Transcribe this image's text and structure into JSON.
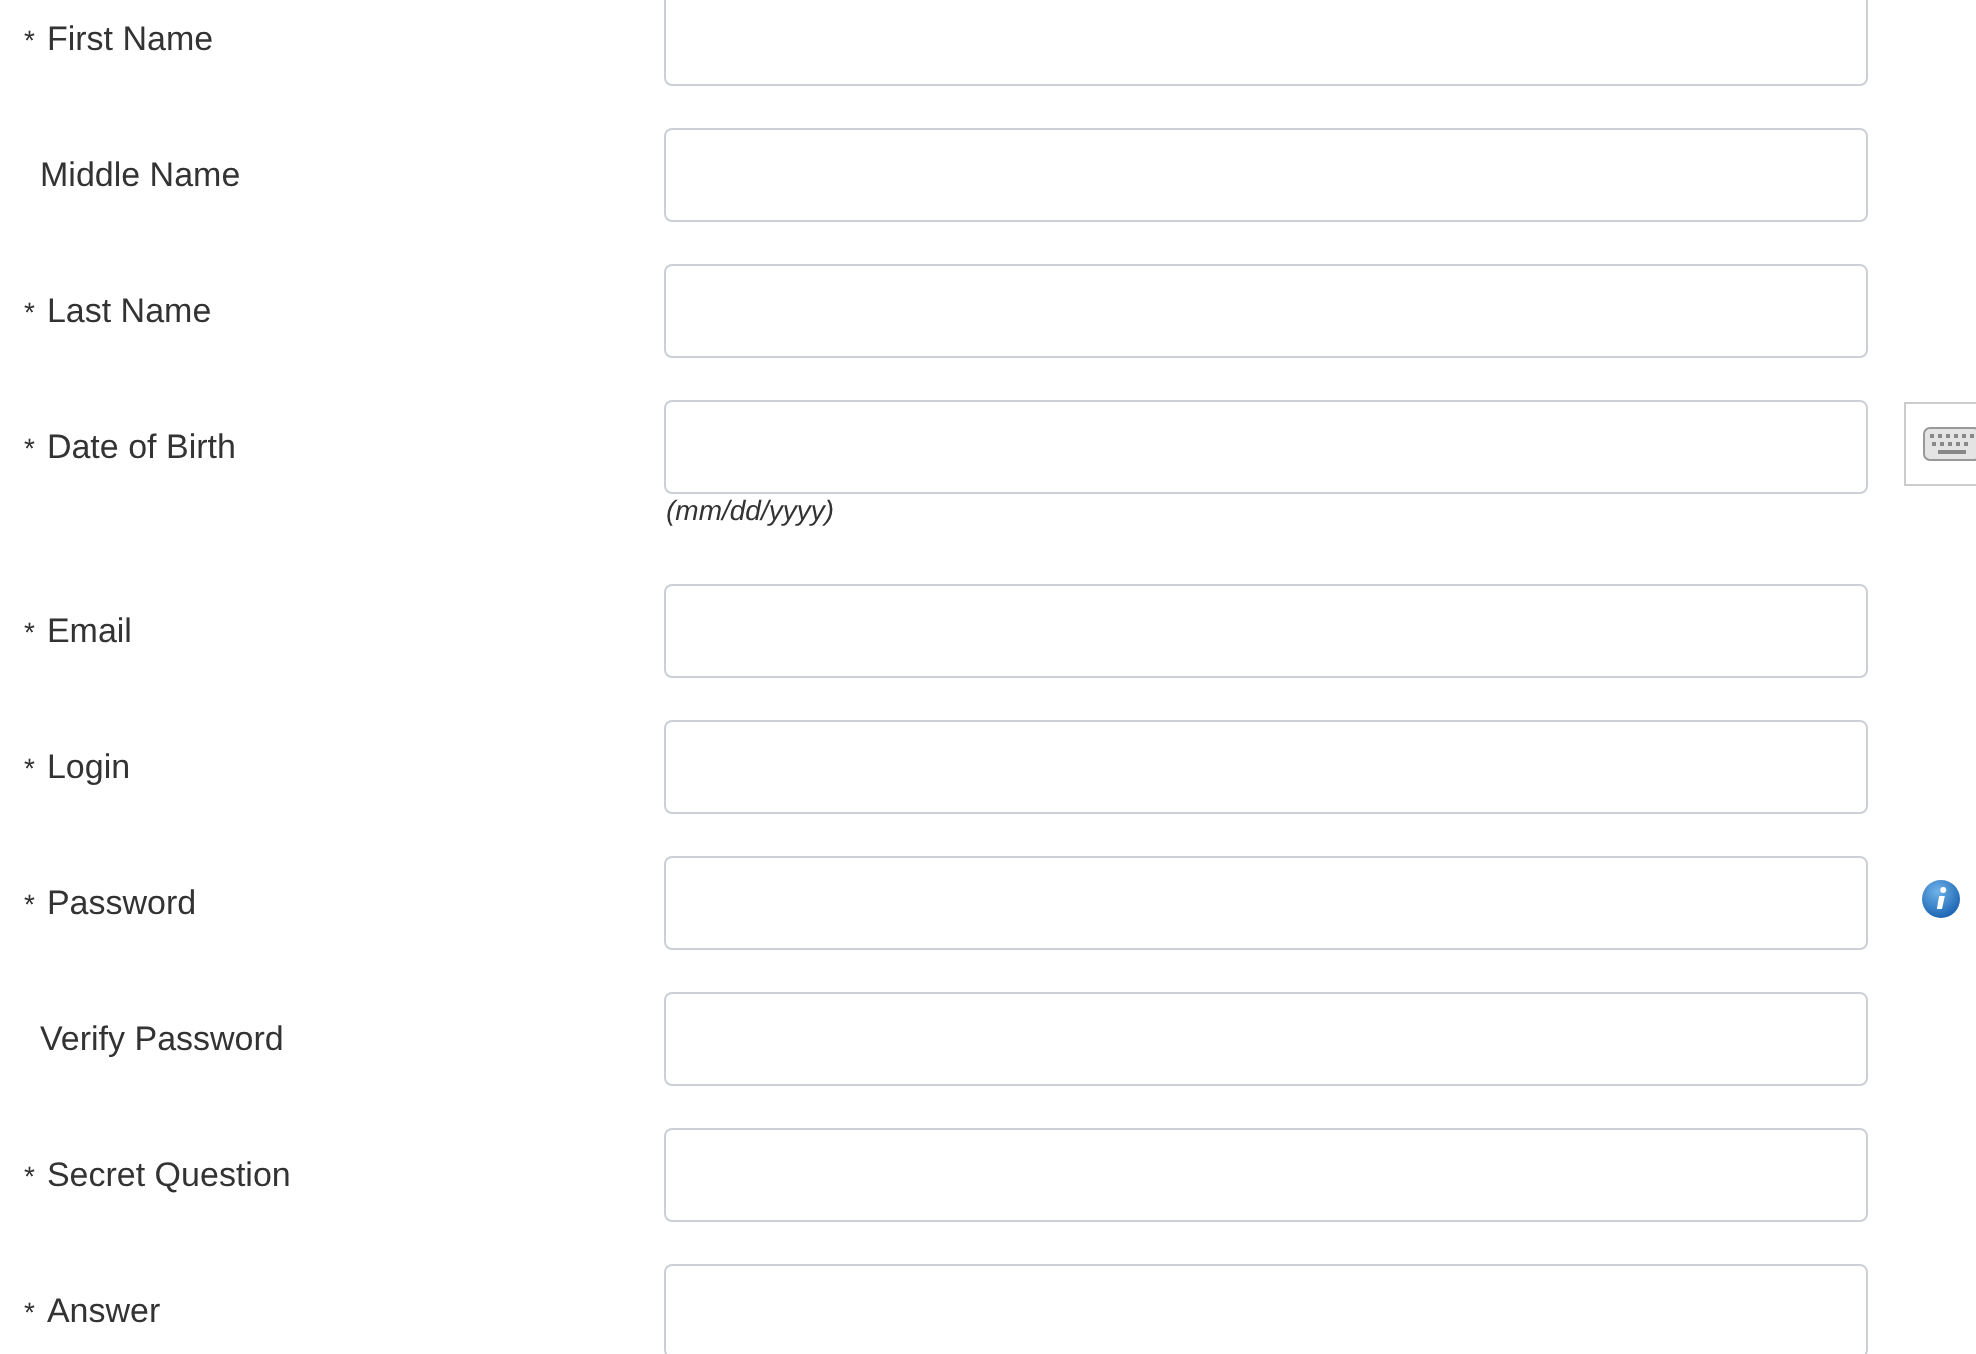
{
  "required_mark": "*",
  "fields": [
    {
      "label": "First Name",
      "required": true,
      "kind": "text"
    },
    {
      "label": "Middle Name",
      "required": false,
      "kind": "text"
    },
    {
      "label": "Last Name",
      "required": true,
      "kind": "text"
    },
    {
      "label": "Date of Birth",
      "required": true,
      "hint": "(mm/dd/yyyy)",
      "kind": "date"
    },
    {
      "label": "Email",
      "required": true,
      "kind": "text"
    },
    {
      "label": "Login",
      "required": true,
      "kind": "text"
    },
    {
      "label": "Password",
      "required": true,
      "kind": "password"
    },
    {
      "label": "Verify Password",
      "required": false,
      "kind": "text"
    },
    {
      "label": "Secret Question",
      "required": true,
      "kind": "text"
    },
    {
      "label": "Answer",
      "required": true,
      "kind": "text"
    }
  ]
}
